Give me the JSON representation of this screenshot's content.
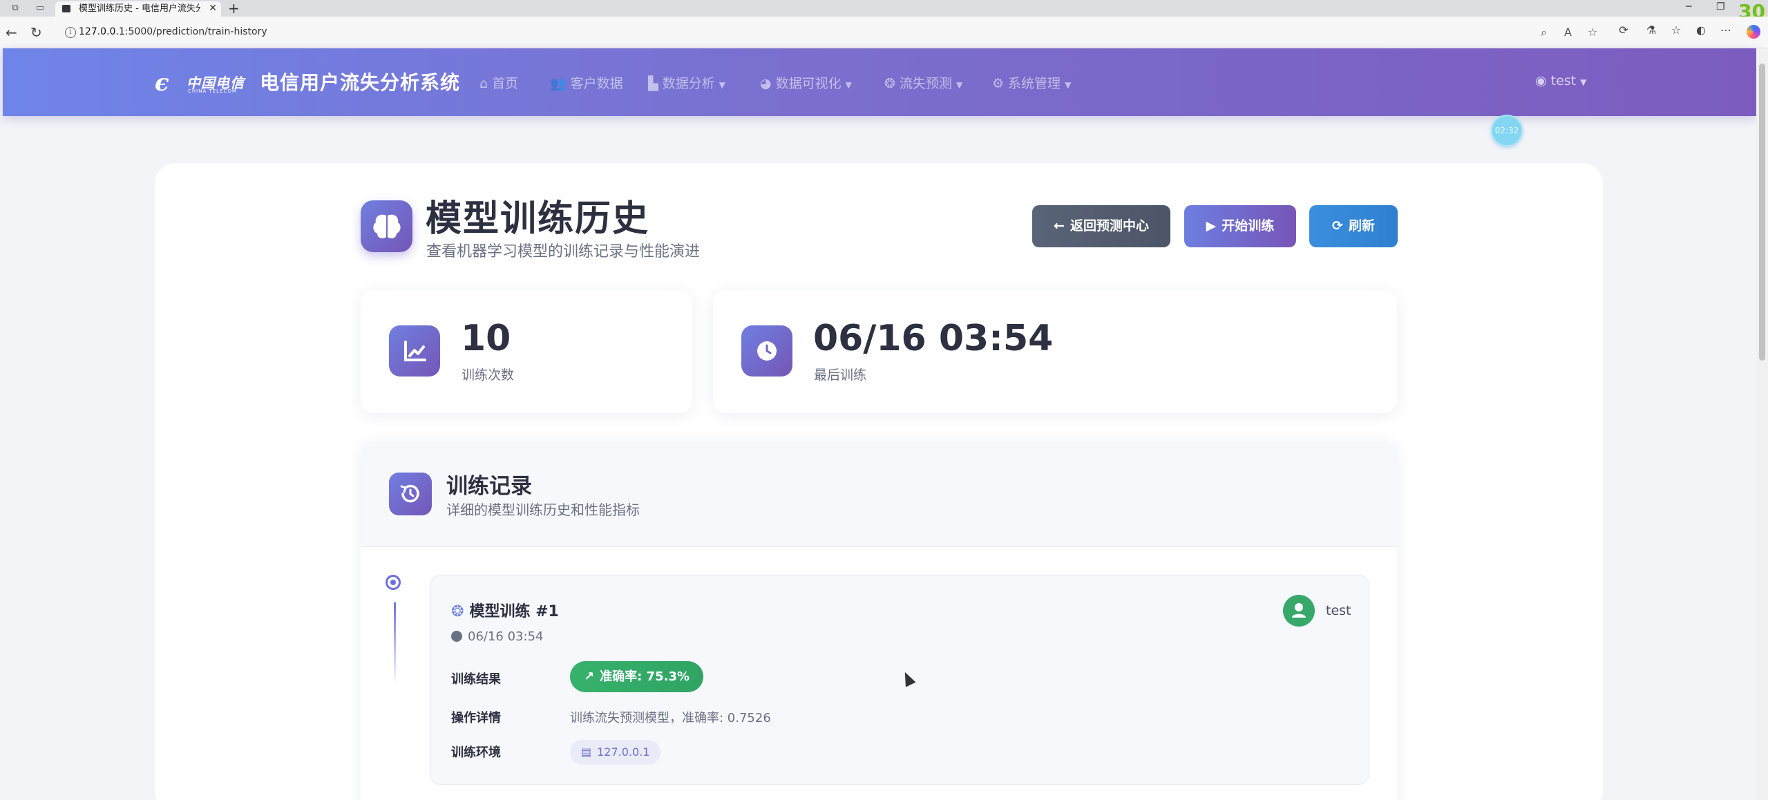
{
  "browser": {
    "tab_title": "模型训练历史 - 电信用户流失分析",
    "url_host": "127.0.0.1",
    "url_path": ":5000/prediction/train-history",
    "badge": "30"
  },
  "header": {
    "logo_cn": "中国电信",
    "logo_en": "CHINA TELECOM",
    "app_name": "电信用户流失分析系统",
    "nav": [
      {
        "label": "首页",
        "icon": "home-icon"
      },
      {
        "label": "客户数据",
        "icon": "users-icon"
      },
      {
        "label": "数据分析",
        "icon": "chart-icon"
      },
      {
        "label": "数据可视化",
        "icon": "pie-icon"
      },
      {
        "label": "流失预测",
        "icon": "brain-icon"
      },
      {
        "label": "系统管理",
        "icon": "gear-icon"
      }
    ],
    "user": "test",
    "timer": "02:32"
  },
  "page": {
    "title": "模型训练历史",
    "subtitle": "查看机器学习模型的训练记录与性能演进",
    "buttons": {
      "back": "返回预测中心",
      "train": "开始训练",
      "refresh": "刷新"
    }
  },
  "stats": [
    {
      "value": "10",
      "label": "训练次数",
      "icon": "line-chart-icon"
    },
    {
      "value": "06/16 03:54",
      "label": "最后训练",
      "icon": "clock-icon"
    }
  ],
  "records": {
    "title": "训练记录",
    "subtitle": "详细的模型训练历史和性能指标",
    "items": [
      {
        "title": "模型训练 #1",
        "time": "06/16 03:54",
        "user": "test",
        "result_label": "训练结果",
        "accuracy": "准确率: 75.3%",
        "detail_label": "操作详情",
        "detail": "训练流失预测模型，准确率: 0.7526",
        "env_label": "训练环境",
        "env": "127.0.0.1"
      }
    ]
  }
}
